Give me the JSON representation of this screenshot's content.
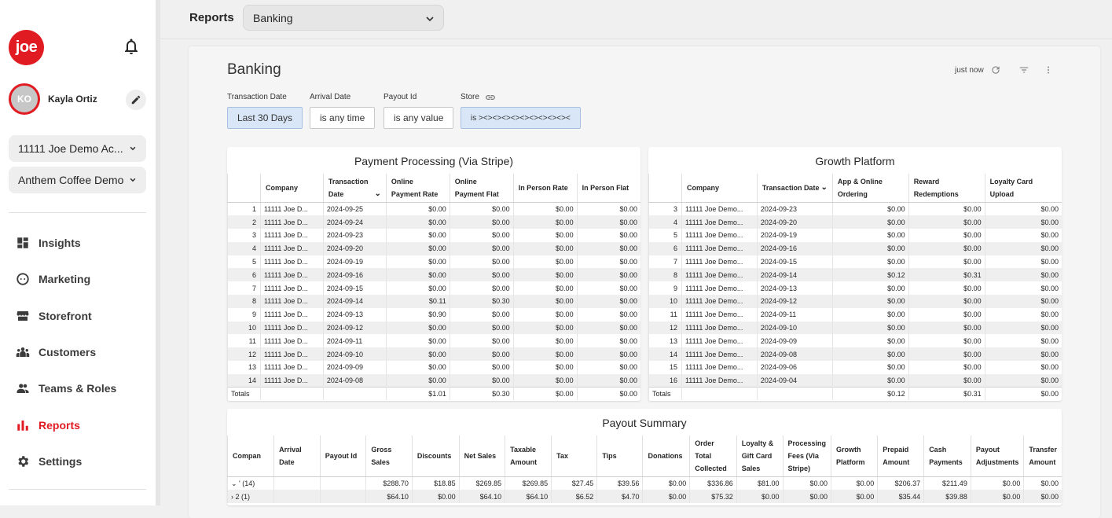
{
  "sidebar": {
    "logo_text": "joe",
    "user": {
      "initials": "KO",
      "name": "Kayla Ortiz"
    },
    "account_select": "11111 Joe Demo Ac...",
    "store_select": "Anthem Coffee Demo",
    "nav": [
      {
        "label": "Insights",
        "icon": "dashboard-icon"
      },
      {
        "label": "Marketing",
        "icon": "chat-icon"
      },
      {
        "label": "Storefront",
        "icon": "storefront-icon"
      },
      {
        "label": "Customers",
        "icon": "people-icon"
      },
      {
        "label": "Teams & Roles",
        "icon": "group-icon"
      },
      {
        "label": "Reports",
        "icon": "bar-chart-icon",
        "active": true
      },
      {
        "label": "Settings",
        "icon": "gear-icon"
      }
    ]
  },
  "topbar": {
    "title": "Reports",
    "report_select": "Banking"
  },
  "dashboard": {
    "title": "Banking",
    "refresh_text": "just now",
    "filters": [
      {
        "label": "Transaction Date",
        "value": "Last 30 Days",
        "active": true
      },
      {
        "label": "Arrival Date",
        "value": "is any time",
        "active": false
      },
      {
        "label": "Payout Id",
        "value": "is any value",
        "active": false
      },
      {
        "label": "Store",
        "value": "is ><><><><><><><><><><",
        "active": true
      }
    ]
  },
  "payment_processing": {
    "title": "Payment Processing (Via Stripe)",
    "headers": [
      "",
      "Company",
      "Transaction Date",
      "Online Payment Rate",
      "Online Payment Flat",
      "In Person Rate",
      "In Person Flat"
    ],
    "rows": [
      [
        "1",
        "11111 Joe D...",
        "2024-09-25",
        "$0.00",
        "$0.00",
        "$0.00",
        "$0.00"
      ],
      [
        "2",
        "11111 Joe D...",
        "2024-09-24",
        "$0.00",
        "$0.00",
        "$0.00",
        "$0.00"
      ],
      [
        "3",
        "11111 Joe D...",
        "2024-09-23",
        "$0.00",
        "$0.00",
        "$0.00",
        "$0.00"
      ],
      [
        "4",
        "11111 Joe D...",
        "2024-09-20",
        "$0.00",
        "$0.00",
        "$0.00",
        "$0.00"
      ],
      [
        "5",
        "11111 Joe D...",
        "2024-09-19",
        "$0.00",
        "$0.00",
        "$0.00",
        "$0.00"
      ],
      [
        "6",
        "11111 Joe D...",
        "2024-09-16",
        "$0.00",
        "$0.00",
        "$0.00",
        "$0.00"
      ],
      [
        "7",
        "11111 Joe D...",
        "2024-09-15",
        "$0.00",
        "$0.00",
        "$0.00",
        "$0.00"
      ],
      [
        "8",
        "11111 Joe D...",
        "2024-09-14",
        "$0.11",
        "$0.30",
        "$0.00",
        "$0.00"
      ],
      [
        "9",
        "11111 Joe D...",
        "2024-09-13",
        "$0.90",
        "$0.00",
        "$0.00",
        "$0.00"
      ],
      [
        "10",
        "11111 Joe D...",
        "2024-09-12",
        "$0.00",
        "$0.00",
        "$0.00",
        "$0.00"
      ],
      [
        "11",
        "11111 Joe D...",
        "2024-09-11",
        "$0.00",
        "$0.00",
        "$0.00",
        "$0.00"
      ],
      [
        "12",
        "11111 Joe D...",
        "2024-09-10",
        "$0.00",
        "$0.00",
        "$0.00",
        "$0.00"
      ],
      [
        "13",
        "11111 Joe D...",
        "2024-09-09",
        "$0.00",
        "$0.00",
        "$0.00",
        "$0.00"
      ],
      [
        "14",
        "11111 Joe D...",
        "2024-09-08",
        "$0.00",
        "$0.00",
        "$0.00",
        "$0.00"
      ]
    ],
    "totals": [
      "Totals",
      "",
      "",
      "$1.01",
      "$0.30",
      "$0.00",
      "$0.00"
    ]
  },
  "growth_platform": {
    "title": "Growth Platform",
    "headers": [
      "",
      "Company",
      "Transaction Date",
      "App & Online Ordering",
      "Reward Redemptions",
      "Loyalty Card Upload"
    ],
    "rows": [
      [
        "3",
        "11111 Joe Demo...",
        "2024-09-23",
        "$0.00",
        "$0.00",
        "$0.00"
      ],
      [
        "4",
        "11111 Joe Demo...",
        "2024-09-20",
        "$0.00",
        "$0.00",
        "$0.00"
      ],
      [
        "5",
        "11111 Joe Demo...",
        "2024-09-19",
        "$0.00",
        "$0.00",
        "$0.00"
      ],
      [
        "6",
        "11111 Joe Demo...",
        "2024-09-16",
        "$0.00",
        "$0.00",
        "$0.00"
      ],
      [
        "7",
        "11111 Joe Demo...",
        "2024-09-15",
        "$0.00",
        "$0.00",
        "$0.00"
      ],
      [
        "8",
        "11111 Joe Demo...",
        "2024-09-14",
        "$0.12",
        "$0.31",
        "$0.00"
      ],
      [
        "9",
        "11111 Joe Demo...",
        "2024-09-13",
        "$0.00",
        "$0.00",
        "$0.00"
      ],
      [
        "10",
        "11111 Joe Demo...",
        "2024-09-12",
        "$0.00",
        "$0.00",
        "$0.00"
      ],
      [
        "11",
        "11111 Joe Demo...",
        "2024-09-11",
        "$0.00",
        "$0.00",
        "$0.00"
      ],
      [
        "12",
        "11111 Joe Demo...",
        "2024-09-10",
        "$0.00",
        "$0.00",
        "$0.00"
      ],
      [
        "13",
        "11111 Joe Demo...",
        "2024-09-09",
        "$0.00",
        "$0.00",
        "$0.00"
      ],
      [
        "14",
        "11111 Joe Demo...",
        "2024-09-08",
        "$0.00",
        "$0.00",
        "$0.00"
      ],
      [
        "15",
        "11111 Joe Demo...",
        "2024-09-06",
        "$0.00",
        "$0.00",
        "$0.00"
      ],
      [
        "16",
        "11111 Joe Demo...",
        "2024-09-04",
        "$0.00",
        "$0.00",
        "$0.00"
      ]
    ],
    "totals": [
      "Totals",
      "",
      "",
      "$0.12",
      "$0.31",
      "$0.00"
    ]
  },
  "payout_summary": {
    "title": "Payout Summary",
    "headers": [
      "Compan",
      "Arrival Date",
      "Payout Id",
      "Gross Sales",
      "Discounts",
      "Net Sales",
      "Taxable Amount",
      "Tax",
      "Tips",
      "Donations",
      "Order Total Collected",
      "Loyalty & Gift Card Sales",
      "Processing Fees (Via Stripe)",
      "Growth Platform",
      "Prepaid Amount",
      "Cash Payments",
      "Payout Adjustments",
      "Transfer Amount"
    ],
    "rows": [
      [
        "' (14)",
        "",
        "",
        "$288.70",
        "$18.85",
        "$269.85",
        "$269.85",
        "$27.45",
        "$39.56",
        "$0.00",
        "$336.86",
        "$81.00",
        "$0.00",
        "$0.00",
        "$206.37",
        "$211.49",
        "$0.00",
        "$0.00"
      ],
      [
        "2 (1)",
        "",
        "",
        "$64.10",
        "$0.00",
        "$64.10",
        "$64.10",
        "$6.52",
        "$4.70",
        "$0.00",
        "$75.32",
        "$0.00",
        "$0.00",
        "$0.00",
        "$35.44",
        "$39.88",
        "$0.00",
        "$0.00"
      ]
    ]
  }
}
